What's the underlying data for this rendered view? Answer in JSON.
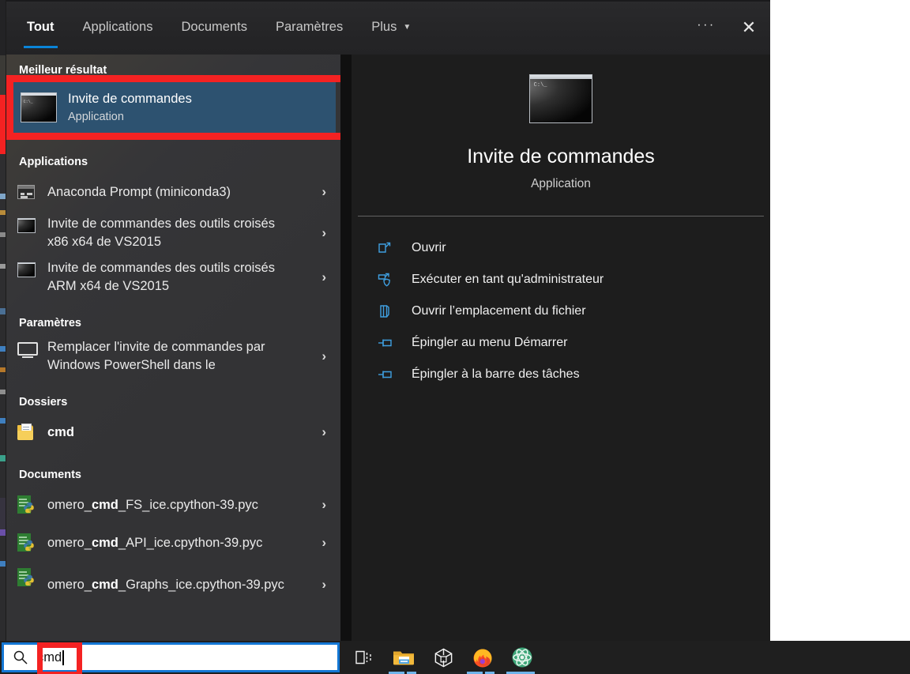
{
  "header": {
    "tabs": [
      {
        "label": "Tout",
        "active": true
      },
      {
        "label": "Applications",
        "active": false
      },
      {
        "label": "Documents",
        "active": false
      },
      {
        "label": "Paramètres",
        "active": false
      },
      {
        "label": "Plus",
        "active": false,
        "caret": "▼"
      }
    ],
    "more_label": "···",
    "close_label": "✕"
  },
  "sections": {
    "best": {
      "title": "Meilleur résultat",
      "item": {
        "title": "Invite de commandes",
        "subtitle": "Application",
        "icon": "cmd-console-icon"
      }
    },
    "applications": {
      "title": "Applications",
      "items": [
        {
          "text": "Anaconda Prompt (miniconda3)",
          "icon": "anaconda-prompt-icon",
          "lines": 1
        },
        {
          "text": "Invite de commandes des outils croisés x86 x64 de VS2015",
          "icon": "cmd-console-icon",
          "lines": 2
        },
        {
          "text": "Invite de commandes des outils croisés ARM x64 de VS2015",
          "icon": "cmd-console-icon",
          "lines": 2
        }
      ]
    },
    "parametres": {
      "title": "Paramètres",
      "items": [
        {
          "text": "Remplacer l'invite de commandes par Windows PowerShell dans le",
          "icon": "settings-monitor-icon",
          "lines": 2
        }
      ]
    },
    "dossiers": {
      "title": "Dossiers",
      "items": [
        {
          "text": "cmd",
          "bold": true,
          "icon": "folder-icon",
          "lines": 1
        }
      ]
    },
    "documents": {
      "title": "Documents",
      "items": [
        {
          "pre": "omero_",
          "match": "cmd",
          "post": "_FS_ice.cpython-39.pyc",
          "icon": "python-file-icon",
          "lines": 1
        },
        {
          "pre": "omero_",
          "match": "cmd",
          "post": "_API_ice.cpython-39.pyc",
          "icon": "python-file-icon",
          "lines": 1
        },
        {
          "pre": "omero_",
          "match": "cmd",
          "post": "_Graphs_ice.cpython-39.pyc",
          "icon": "python-file-icon",
          "lines": 2
        }
      ]
    },
    "chevron": "›"
  },
  "detail": {
    "icon": "cmd-console-icon",
    "icon_prompt": "C:\\_",
    "title": "Invite de commandes",
    "subtitle": "Application",
    "actions": [
      {
        "label": "Ouvrir",
        "icon": "open-window-icon"
      },
      {
        "label": "Exécuter en tant qu'administrateur",
        "icon": "shield-admin-icon"
      },
      {
        "label": "Ouvrir l’emplacement du fichier",
        "icon": "folder-location-icon"
      },
      {
        "label": "Épingler au menu Démarrer",
        "icon": "pin-icon"
      },
      {
        "label": "Épingler à la barre des tâches",
        "icon": "pin-icon"
      }
    ]
  },
  "taskbar": {
    "search": {
      "value": "cmd",
      "icon": "search-icon"
    },
    "icons": [
      {
        "name": "task-view-icon",
        "indicators": 0
      },
      {
        "name": "file-explorer-icon",
        "indicators": 2
      },
      {
        "name": "cube-3d-viewer-icon",
        "indicators": 0
      },
      {
        "name": "firefox-icon",
        "indicators": 2
      },
      {
        "name": "atom-editor-icon",
        "indicators": 1
      }
    ]
  },
  "colors": {
    "accent": "#0a84d8",
    "selection": "#2d5270",
    "annotation": "#f42222",
    "panel_bg": "#1c1c1c",
    "list_bg": "#333335",
    "taskbar_bg": "#1f1f1f",
    "action_icon": "#3f9fe0"
  }
}
